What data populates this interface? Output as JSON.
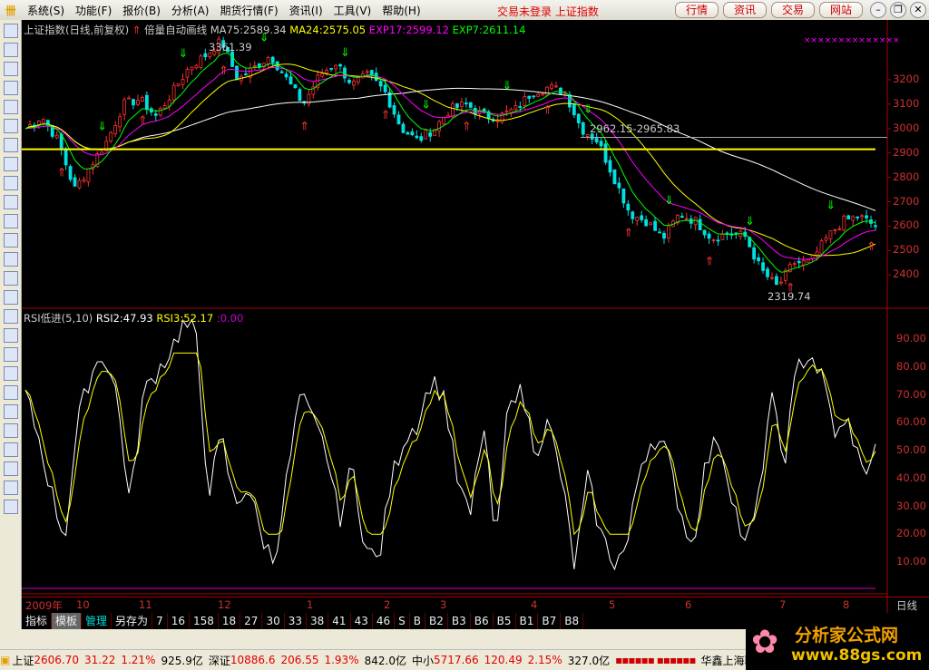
{
  "menu": {
    "items": [
      "系统(S)",
      "功能(F)",
      "报价(B)",
      "分析(A)",
      "期货行情(F)",
      "资讯(I)",
      "工具(V)",
      "帮助(H)"
    ],
    "login_status": "交易未登录 上证指数",
    "buttons": [
      "行情",
      "资讯",
      "交易",
      "网站"
    ]
  },
  "chart_header": {
    "title": "上证指数(日线,前复权)",
    "auto_draw": "倍量自动画线",
    "ma75": "MA75:2589.34",
    "ma24": "MA24:2575.05",
    "exp17": "EXP17:2599.12",
    "exp7": "EXP7:2611.14"
  },
  "annotations": {
    "high": "3361.39",
    "mid": "2962.15-2965.83",
    "low": "2319.74"
  },
  "price_axis": [
    "3200",
    "3100",
    "3000",
    "2900",
    "2800",
    "2700",
    "2600",
    "2500",
    "2400"
  ],
  "rsi_header": {
    "name": "RSI低进(5,10)",
    "rsi2": "RSI2:47.93",
    "rsi3": "RSI3:52.17",
    "other": ":0.00"
  },
  "rsi_axis": [
    "90.00",
    "80.00",
    "70.00",
    "60.00",
    "50.00",
    "40.00",
    "30.00",
    "20.00",
    "10.00"
  ],
  "dates": [
    "2009年",
    "10",
    "11",
    "12",
    "1",
    "2",
    "3",
    "4",
    "5",
    "6",
    "7",
    "8"
  ],
  "period": "日线",
  "tabs": [
    "指标",
    "模板",
    "管理",
    "另存为",
    "7",
    "16",
    "158",
    "18",
    "27",
    "30",
    "33",
    "38",
    "41",
    "43",
    "46",
    "S",
    "B",
    "B2",
    "B3",
    "B6",
    "B5",
    "B1",
    "B7",
    "B8"
  ],
  "status": {
    "sh_label": "上证",
    "sh": "2606.70",
    "sh_chg": "31.22",
    "sh_pct": "1.21%",
    "sh_vol": "925.9亿",
    "sz_label": "深证",
    "sz": "10886.6",
    "sz_chg": "206.55",
    "sz_pct": "1.93%",
    "sz_vol": "842.0亿",
    "zx_label": "中小",
    "zx": "5717.66",
    "zx_chg": "120.49",
    "zx_pct": "2.15%",
    "zx_vol": "327.0亿",
    "broker": "华鑫上海联通行情"
  },
  "brand": {
    "name": "分析家公式网",
    "url": "www.88gs.com"
  },
  "colors": {
    "up": "#ff3030",
    "down": "#00e0e0",
    "ma75": "#ffffff",
    "ma24": "#ffff00",
    "exp17": "#ff00ff",
    "exp7": "#00ff00",
    "support": "#ffff00"
  },
  "chart_data": {
    "type": "candlestick",
    "support_level": 2915,
    "ylim": [
      2330,
      3390
    ],
    "closes": [
      3000,
      3050,
      2950,
      2750,
      2850,
      2950,
      3100,
      3120,
      3050,
      3150,
      3250,
      3300,
      3360,
      3200,
      3250,
      3300,
      3200,
      3100,
      3220,
      3270,
      3180,
      3220,
      3150,
      3000,
      2950,
      3000,
      3080,
      3100,
      3050,
      3050,
      3080,
      3150,
      3170,
      3150,
      3000,
      2950,
      2800,
      2650,
      2620,
      2550,
      2650,
      2620,
      2550,
      2570,
      2560,
      2420,
      2350,
      2450,
      2450,
      2550,
      2620,
      2640,
      2600
    ],
    "rsi1": [
      70,
      55,
      35,
      18,
      60,
      78,
      85,
      70,
      30,
      70,
      78,
      85,
      95,
      93,
      35,
      55,
      30,
      38,
      20,
      10,
      40,
      70,
      60,
      50,
      25,
      45,
      15,
      10,
      40,
      55,
      60,
      75,
      70,
      40,
      25,
      60,
      15,
      72,
      70,
      50,
      60,
      40,
      8,
      40,
      20,
      10,
      15,
      45,
      55,
      50,
      30,
      15,
      45,
      55,
      35,
      15,
      30,
      70,
      45,
      80,
      85,
      75,
      55,
      60,
      42,
      50
    ],
    "rsi_ylim": [
      0,
      100
    ]
  }
}
